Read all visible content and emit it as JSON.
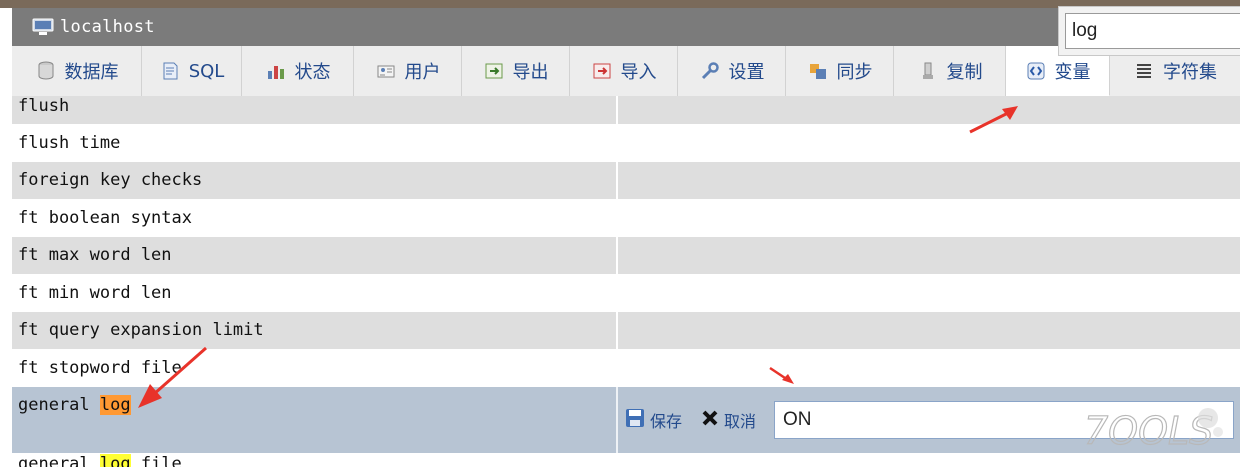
{
  "window": {
    "title": "localhost",
    "server_icon": "server-icon"
  },
  "search": {
    "value": "log"
  },
  "tabs": [
    {
      "label": "数据库",
      "icon": "database-icon"
    },
    {
      "label": "SQL",
      "icon": "sql-icon"
    },
    {
      "label": "状态",
      "icon": "status-chart-icon"
    },
    {
      "label": "用户",
      "icon": "users-icon"
    },
    {
      "label": "导出",
      "icon": "export-icon"
    },
    {
      "label": "导入",
      "icon": "import-icon"
    },
    {
      "label": "设置",
      "icon": "wrench-icon"
    },
    {
      "label": "同步",
      "icon": "sync-icon"
    },
    {
      "label": "复制",
      "icon": "replication-icon"
    },
    {
      "label": "变量",
      "icon": "variables-icon",
      "active": true
    },
    {
      "label": "字符集",
      "icon": "charset-icon"
    }
  ],
  "variables": [
    {
      "name": "flush"
    },
    {
      "name": "flush time"
    },
    {
      "name": "foreign key checks"
    },
    {
      "name": "ft boolean syntax"
    },
    {
      "name": "ft max word len"
    },
    {
      "name": "ft min word len"
    },
    {
      "name": "ft query expansion limit"
    },
    {
      "name": "ft stopword file"
    }
  ],
  "editing_row": {
    "name_prefix": "general ",
    "name_match": "log",
    "save_label": "保存",
    "cancel_label": "取消",
    "value": "ON"
  },
  "partial_row": {
    "name_prefix": "general ",
    "name_match": "log",
    "name_suffix": " file"
  },
  "watermark": {
    "text": "7OOLS"
  },
  "colors": {
    "accent": "#234a8c",
    "highlight_orange": "#ff9933",
    "highlight_yellow": "#ffff33",
    "arrow": "#e8332a"
  }
}
